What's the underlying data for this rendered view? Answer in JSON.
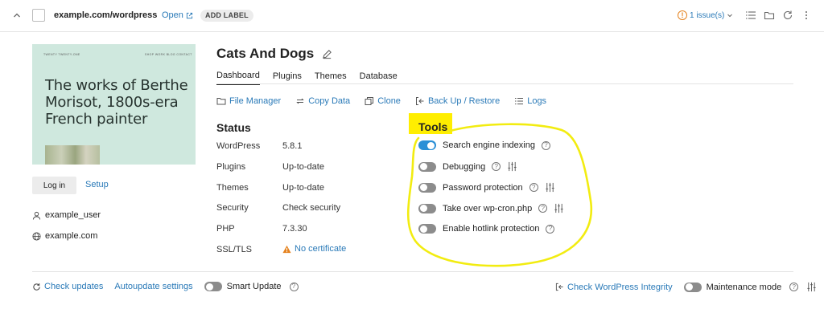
{
  "header": {
    "site_url": "example.com/wordpress",
    "open_label": "Open",
    "add_label": "ADD LABEL",
    "issues_label": "1 issue(s)"
  },
  "thumbnail": {
    "nav_left": "TWENTY TWENTY-ONE",
    "nav_right": "SHOP  WORK  BLOG  CONTACT",
    "headline": "The works of Berthe Morisot, 1800s-era French painter"
  },
  "sidebar": {
    "login_label": "Log in",
    "setup_label": "Setup",
    "user": "example_user",
    "domain": "example.com"
  },
  "main": {
    "title": "Cats And Dogs",
    "tabs": [
      {
        "label": "Dashboard",
        "active": true
      },
      {
        "label": "Plugins"
      },
      {
        "label": "Themes"
      },
      {
        "label": "Database"
      }
    ],
    "actions": [
      {
        "label": "File Manager",
        "icon": "folder-icon"
      },
      {
        "label": "Copy Data",
        "icon": "sync-icon"
      },
      {
        "label": "Clone",
        "icon": "clone-icon"
      },
      {
        "label": "Back Up / Restore",
        "icon": "backup-icon"
      },
      {
        "label": "Logs",
        "icon": "list-icon"
      }
    ]
  },
  "status": {
    "heading": "Status",
    "rows": [
      {
        "label": "WordPress",
        "value": "5.8.1"
      },
      {
        "label": "Plugins",
        "value": "Up-to-date"
      },
      {
        "label": "Themes",
        "value": "Up-to-date"
      },
      {
        "label": "Security",
        "value": "Check security"
      },
      {
        "label": "PHP",
        "value": "7.3.30"
      },
      {
        "label": "SSL/TLS",
        "value": "No certificate"
      }
    ]
  },
  "tools": {
    "heading": "Tools",
    "items": [
      {
        "label": "Search engine indexing",
        "enabled": true
      },
      {
        "label": "Debugging",
        "enabled": false
      },
      {
        "label": "Password protection",
        "enabled": false
      },
      {
        "label": "Take over wp-cron.php",
        "enabled": false
      },
      {
        "label": "Enable hotlink protection",
        "enabled": false
      }
    ]
  },
  "footer": {
    "check_updates": "Check updates",
    "autoupdate_settings": "Autoupdate settings",
    "smart_update": "Smart Update",
    "check_integrity": "Check WordPress Integrity",
    "maintenance_mode": "Maintenance mode"
  },
  "colors": {
    "accent": "#2a7ab8",
    "toggle_on": "#2a8fd6",
    "highlight": "#ffee00",
    "warning": "#e5821e"
  }
}
